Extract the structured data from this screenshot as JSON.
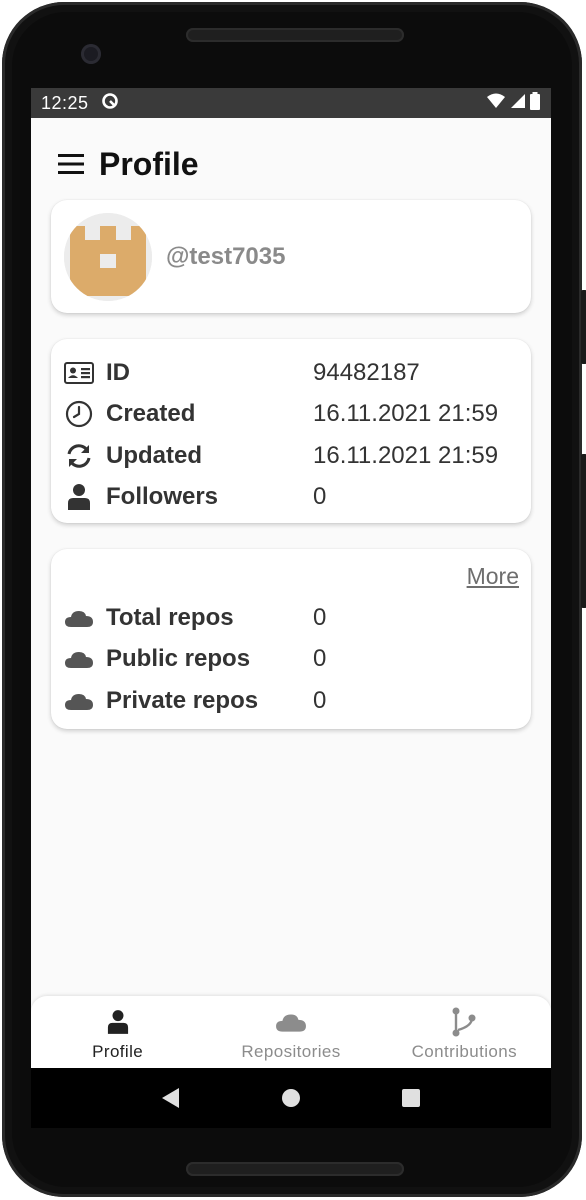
{
  "statusbar": {
    "time": "12:25"
  },
  "appbar": {
    "title": "Profile"
  },
  "profile": {
    "username": "@test7035"
  },
  "info": {
    "rows": [
      {
        "icon": "id-card-icon",
        "label": "ID",
        "value": "94482187"
      },
      {
        "icon": "clock-icon",
        "label": "Created",
        "value": "16.11.2021 21:59"
      },
      {
        "icon": "sync-icon",
        "label": "Updated",
        "value": "16.11.2021 21:59"
      },
      {
        "icon": "user-icon",
        "label": "Followers",
        "value": "0"
      }
    ]
  },
  "repos": {
    "more_label": "More",
    "rows": [
      {
        "icon": "cloud-icon",
        "label": "Total repos",
        "value": "0"
      },
      {
        "icon": "cloud-icon",
        "label": "Public repos",
        "value": "0"
      },
      {
        "icon": "cloud-icon",
        "label": "Private repos",
        "value": "0"
      }
    ]
  },
  "bottom_nav": {
    "items": [
      {
        "icon": "user-icon",
        "label": "Profile",
        "active": true
      },
      {
        "icon": "cloud-icon",
        "label": "Repositories",
        "active": false
      },
      {
        "icon": "branch-icon",
        "label": "Contributions",
        "active": false
      }
    ]
  },
  "colors": {
    "active_nav": "#222222",
    "inactive_nav": "#8c8c8c",
    "avatar_fill": "#dcab6a",
    "avatar_bg": "#ececec",
    "statusbar_bg": "#3a3a3a"
  }
}
